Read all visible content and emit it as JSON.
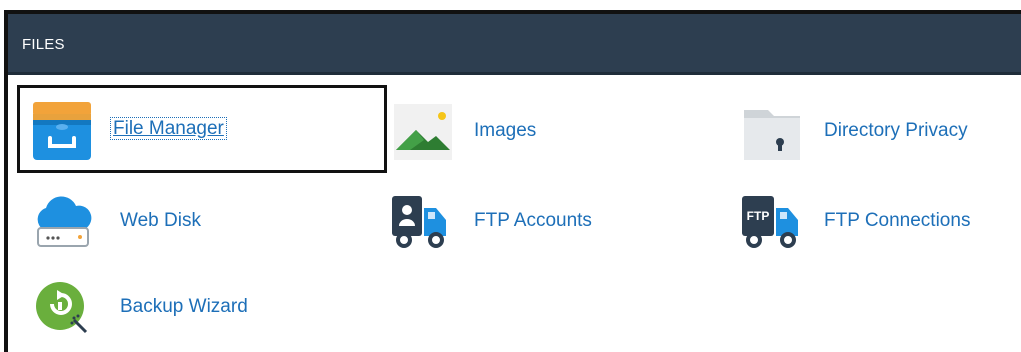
{
  "header": {
    "title": "FILES"
  },
  "items": [
    {
      "label": "File Manager",
      "icon": "file-manager-icon"
    },
    {
      "label": "Images",
      "icon": "images-icon"
    },
    {
      "label": "Directory Privacy",
      "icon": "directory-privacy-icon"
    },
    {
      "label": "Web Disk",
      "icon": "web-disk-icon"
    },
    {
      "label": "FTP Accounts",
      "icon": "ftp-accounts-icon"
    },
    {
      "label": "FTP Connections",
      "icon": "ftp-connections-icon"
    },
    {
      "label": "Backup Wizard",
      "icon": "backup-wizard-icon"
    }
  ],
  "ftp_badge": "FTP",
  "colors": {
    "header_bg": "#2d3e50",
    "link": "#1d6fb8"
  }
}
